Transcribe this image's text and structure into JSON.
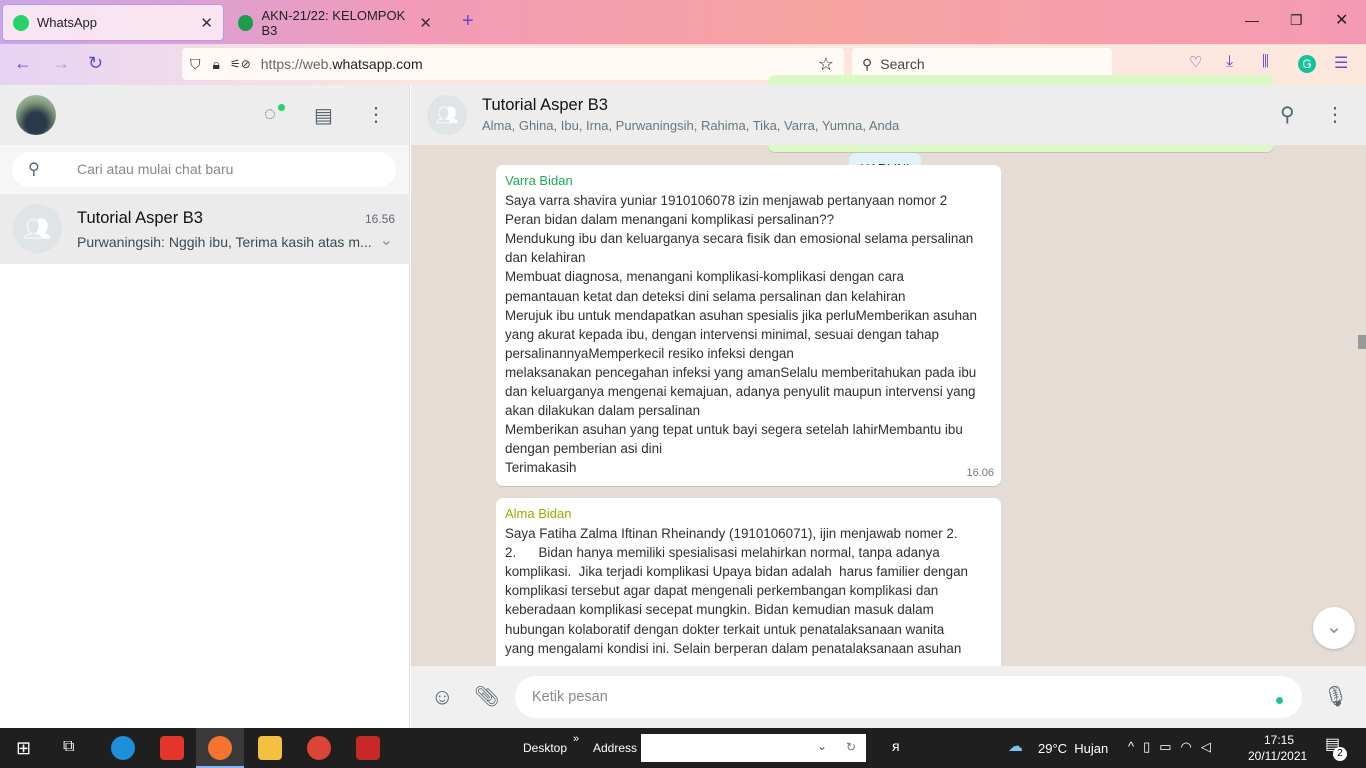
{
  "browser": {
    "tabs": [
      {
        "label": "WhatsApp",
        "active": true
      },
      {
        "label": "AKN-21/22: KELOMPOK B3",
        "active": false
      }
    ],
    "url_prefix": "https://web.",
    "url_domain": "whatsapp.com",
    "search_placeholder": "Search"
  },
  "sidebar": {
    "search_placeholder": "Cari atau mulai chat baru",
    "chats": [
      {
        "name": "Tutorial Asper B3",
        "time": "16.56",
        "preview": "Purwaningsih: Nggih ibu, Terima kasih atas m..."
      }
    ]
  },
  "conversation": {
    "title": "Tutorial Asper B3",
    "members": "Alma, Ghina, Ibu, Irna, Purwaningsih, Rahima, Tika, Varra, Yumna, Anda",
    "date_badge": "HARI INI",
    "prev_time": "16.06",
    "messages": [
      {
        "sender": "Varra Bidan",
        "sender_color": "#1fa855",
        "time": "16.06",
        "lines": [
          "Saya varra shavira yuniar 1910106078 izin menjawab pertanyaan nomor 2",
          "Peran bidan dalam menangani komplikasi persalinan??",
          "Mendukung ibu dan keluarganya secara fisik dan emosional selama persalinan",
          "dan kelahiran",
          "Membuat diagnosa, menangani komplikasi-komplikasi dengan cara",
          "pemantauan ketat dan deteksi dini selama persalinan dan kelahiran",
          "Merujuk ibu untuk mendapatkan asuhan spesialis jika perluMemberikan asuhan",
          "yang akurat kepada ibu, dengan intervensi minimal, sesuai dengan tahap",
          "persalinannyaMemperkecil resiko infeksi dengan",
          "melaksanakan pencegahan infeksi yang amanSelalu memberitahukan pada ibu",
          "dan keluarganya mengenai kemajuan, adanya penyulit maupun intervensi yang",
          "akan dilakukan dalam persalinan",
          "Memberikan asuhan yang tepat untuk bayi segera setelah lahirMembantu ibu",
          "dengan pemberian asi dini",
          "Terimakasih"
        ]
      },
      {
        "sender": "Alma Bidan",
        "sender_color": "#8fb000",
        "lines": [
          "Saya Fatiha Zalma Iftinan Rheinandy (1910106071), ijin menjawab nomer 2.",
          "2.      Bidan hanya memiliki spesialisasi melahirkan normal, tanpa adanya",
          "komplikasi.  Jika terjadi komplikasi Upaya bidan adalah  harus familier dengan",
          "komplikasi tersebut agar dapat mengenali perkembangan komplikasi dan",
          "keberadaan komplikasi secepat mungkin. Bidan kemudian masuk dalam",
          "hubungan kolaboratif dengan dokter terkait untuk penatalaksanaan wanita",
          "yang mengalami kondisi ini. Selain berperan dalam penatalaksanaan asuhan"
        ]
      }
    ],
    "input_placeholder": "Ketik pesan"
  },
  "taskbar": {
    "desktop": "Desktop",
    "address": "Address",
    "weather": "29°C  Hujan",
    "time": "17:15",
    "date": "20/11/2021",
    "notifications": "2"
  }
}
